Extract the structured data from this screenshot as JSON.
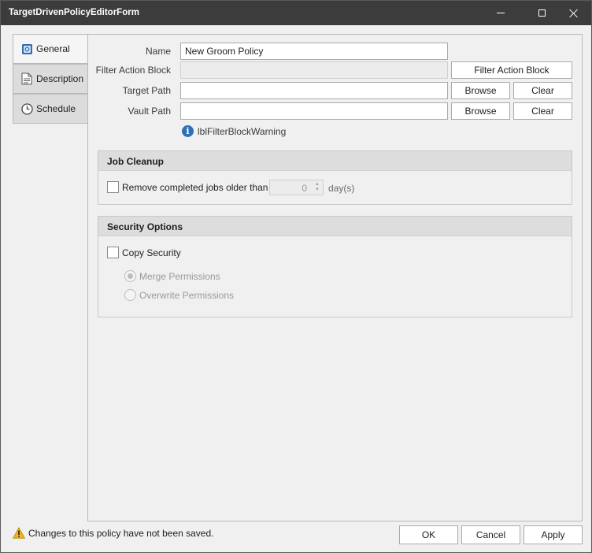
{
  "window": {
    "title": "TargetDrivenPolicyEditorForm"
  },
  "tabs": [
    {
      "label": "General",
      "icon": "safe-icon",
      "active": true
    },
    {
      "label": "Description",
      "icon": "document-icon",
      "active": false
    },
    {
      "label": "Schedule",
      "icon": "clock-icon",
      "active": false
    }
  ],
  "form": {
    "name_label": "Name",
    "name_value": "New Groom Policy",
    "filter_label": "Filter Action Block",
    "filter_value": "",
    "filter_button": "Filter Action Block",
    "target_label": "Target Path",
    "target_value": "",
    "vault_label": "Vault Path",
    "vault_value": "",
    "browse_label": "Browse",
    "clear_label": "Clear",
    "warning_label": "lblFilterBlockWarning"
  },
  "job_cleanup": {
    "header": "Job Cleanup",
    "checkbox_label": "Remove completed jobs older than",
    "days_value": "0",
    "days_suffix": "day(s)"
  },
  "security": {
    "header": "Security Options",
    "copy_label": "Copy Security",
    "merge_label": "Merge Permissions",
    "overwrite_label": "Overwrite Permissions"
  },
  "status": {
    "message": "Changes to this policy have not been saved."
  },
  "footer": {
    "ok": "OK",
    "cancel": "Cancel",
    "apply": "Apply"
  }
}
